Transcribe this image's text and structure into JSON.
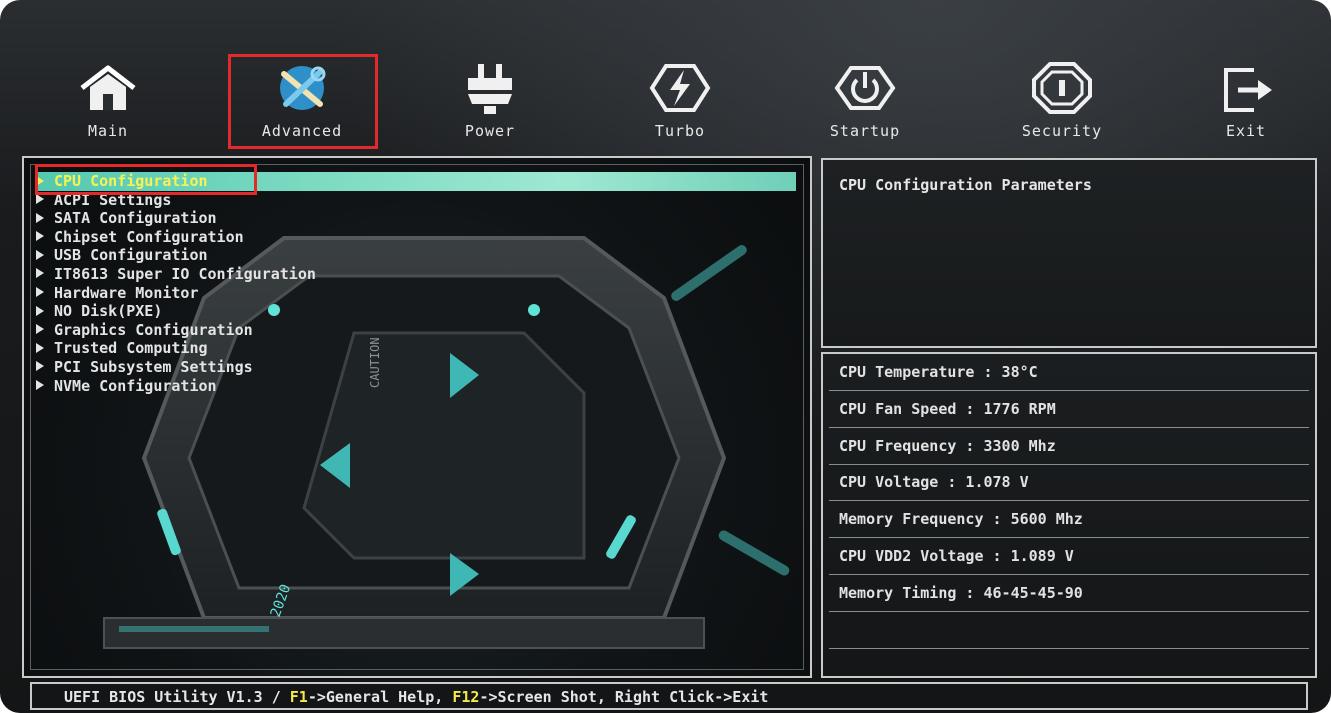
{
  "nav": {
    "items": [
      {
        "label": "Main",
        "icon": "home-icon"
      },
      {
        "label": "Advanced",
        "icon": "tools-icon"
      },
      {
        "label": "Power",
        "icon": "power-plug-icon"
      },
      {
        "label": "Turbo",
        "icon": "lightning-icon"
      },
      {
        "label": "Startup",
        "icon": "power-button-icon"
      },
      {
        "label": "Security",
        "icon": "shield-icon"
      },
      {
        "label": "Exit",
        "icon": "exit-icon"
      }
    ],
    "selected": "Advanced"
  },
  "menu": {
    "items": [
      {
        "label": "CPU Configuration"
      },
      {
        "label": "ACPI Settings"
      },
      {
        "label": "SATA Configuration"
      },
      {
        "label": "Chipset Configuration"
      },
      {
        "label": "USB Configuration"
      },
      {
        "label": "IT8613 Super IO Configuration"
      },
      {
        "label": "Hardware Monitor"
      },
      {
        "label": "NO Disk(PXE)"
      },
      {
        "label": "Graphics Configuration"
      },
      {
        "label": "Trusted Computing"
      },
      {
        "label": "PCI Subsystem Settings"
      },
      {
        "label": "NVMe Configuration"
      }
    ],
    "selected": "CPU Configuration"
  },
  "help": {
    "title": "CPU Configuration Parameters"
  },
  "status": {
    "rows": [
      {
        "text": "CPU Temperature : 38°C"
      },
      {
        "text": "CPU Fan Speed : 1776 RPM"
      },
      {
        "text": "CPU Frequency : 3300 Mhz"
      },
      {
        "text": "CPU Voltage : 1.078 V"
      },
      {
        "text": "Memory Frequency : 5600 Mhz"
      },
      {
        "text": "CPU VDD2 Voltage : 1.089 V"
      },
      {
        "text": "Memory Timing : 46-45-45-90"
      }
    ]
  },
  "artwork": {
    "caution_text": "CAUTION",
    "year_text": "2020"
  },
  "footer": {
    "prefix": "UEFI BIOS Utility V1.3 / ",
    "f1_key": "F1",
    "f1_text": "->General Help, ",
    "f12_key": "F12",
    "f12_text": "->Screen Shot, Right Click->Exit"
  },
  "colors": {
    "highlight": "#7fdcc4",
    "key_yellow": "#f3e94a",
    "selection_outline": "#e22a2a",
    "accent_teal": "#3fb8b5"
  }
}
